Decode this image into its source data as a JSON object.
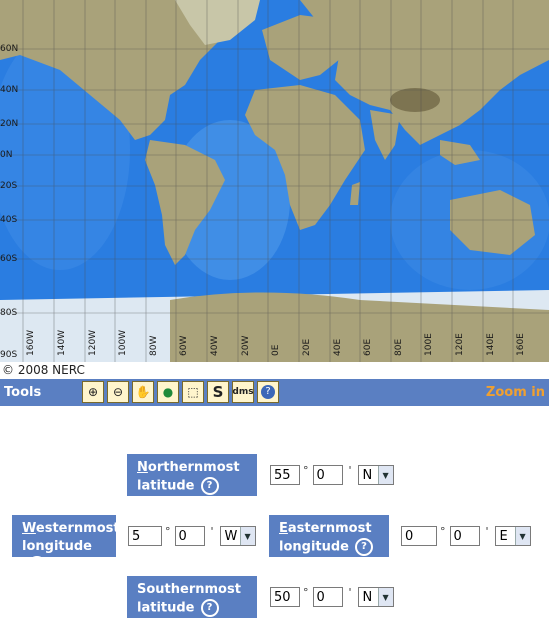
{
  "map": {
    "lat_labels": [
      "60N",
      "40N",
      "20N",
      "0N",
      "20S",
      "40S",
      "60S",
      "80S",
      "90S"
    ],
    "lon_labels": [
      "160W",
      "140W",
      "120W",
      "100W",
      "80W",
      "60W",
      "40W",
      "20W",
      "0E",
      "20E",
      "40E",
      "60E",
      "80E",
      "100E",
      "120E",
      "140E",
      "160E"
    ],
    "colors": {
      "ocean": "#2a7de1",
      "land": "#a9a27a",
      "ice": "#dde8f2",
      "grid": "#4a4a4a"
    }
  },
  "copyright": "© 2008 NERC",
  "toolbar": {
    "title": "Tools",
    "mode": "Zoom in",
    "buttons": [
      {
        "icon": "zoom-in-icon",
        "glyph": "⊕"
      },
      {
        "icon": "zoom-out-icon",
        "glyph": "⊖"
      },
      {
        "icon": "pan-hand-icon",
        "glyph": "✋"
      },
      {
        "icon": "globe-icon",
        "glyph": "●"
      },
      {
        "icon": "select-box-icon",
        "glyph": "⬚"
      },
      {
        "icon": "s-icon",
        "glyph": "S"
      },
      {
        "icon": "dms-icon",
        "glyph": "dms"
      },
      {
        "icon": "help-icon",
        "glyph": "?"
      }
    ]
  },
  "form": {
    "north": {
      "label_first": "N",
      "label_rest": "orthernmost",
      "label_line2": "latitude",
      "deg": "55",
      "min": "0",
      "dir": "N"
    },
    "west": {
      "label_first": "W",
      "label_rest": "esternmost",
      "label_line2": "longitude",
      "deg": "5",
      "min": "0",
      "dir": "W"
    },
    "east": {
      "label_first": "E",
      "label_rest": "asternmost",
      "label_line2": "longitude",
      "deg": "0",
      "min": "0",
      "dir": "E"
    },
    "south": {
      "label_first": "",
      "label_rest": "Southernmost",
      "label_line2": "latitude",
      "deg": "50",
      "min": "0",
      "dir": "N"
    },
    "deg_symbol": "°",
    "min_symbol": "'",
    "help_glyph": "?"
  }
}
